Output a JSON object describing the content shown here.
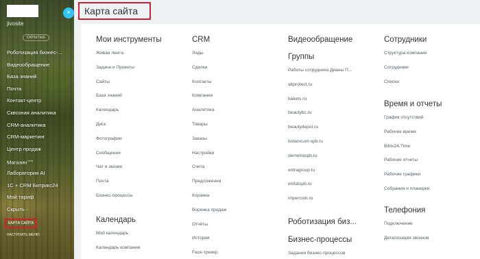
{
  "sidebar": {
    "site_name": "jivosite",
    "hidden_pill": "СКРЫТЫЕ",
    "items": [
      {
        "label": "Роботизация бизнес-..."
      },
      {
        "label": "Видеообращение"
      },
      {
        "label": "База знаний"
      },
      {
        "label": "Почта"
      },
      {
        "label": "Контакт-центр"
      },
      {
        "label": "Сквозная аналитика"
      },
      {
        "label": "CRM-аналитика"
      },
      {
        "label": "CRM-маркетинг"
      },
      {
        "label": "Центр продаж"
      },
      {
        "label": "Магазин",
        "badge": "beta"
      },
      {
        "label": "Лаборатория AI"
      },
      {
        "label": "1С + CRM Битрикс24"
      },
      {
        "label": "Мой тариф"
      },
      {
        "label": "Скрыть -"
      }
    ],
    "sitemap_label": "КАРТА САЙТА",
    "configure_label": "НАСТРОИТЬ МЕНЮ"
  },
  "close_button": "×",
  "panel": {
    "title": "Карта сайта",
    "columns": [
      {
        "sections": [
          {
            "title": "Мои инструменты",
            "links": [
              "Живая лента",
              "Задачи и Проекты",
              "Сайты",
              "База знаний",
              "Календарь",
              "Диск",
              "Фотографии",
              "Сообщения",
              "Чат и звонки",
              "Почта",
              "Бизнес-процессы"
            ]
          },
          {
            "title": "Календарь",
            "links": [
              "Мой календарь",
              "Календарь компании"
            ]
          }
        ]
      },
      {
        "sections": [
          {
            "title": "CRM",
            "links": [
              "Лиды",
              "Сделки",
              "Контакты",
              "Компании",
              "Аналитика",
              "Товары",
              "Заказы",
              "Настройки",
              "Счета",
              "Предложения",
              "Корзина",
              "Воронка продаж",
              "Отчёты",
              "История",
              "Face-трекер"
            ]
          }
        ]
      },
      {
        "sections": [
          {
            "title": "Видеообращение",
            "links": []
          },
          {
            "title": "Группы",
            "links": [
              "Работы сотрудника Дианы П...",
              "abprotect.ru",
              "bakets.ru",
              "beautybc.ru",
              "beautydepot.ru",
              "botanicum-spb.ru",
              "demetraspb.ru",
              "entragroup.ru",
              "etrilatspb.ru",
              "impercoin.ru"
            ]
          },
          {
            "title": "Роботизация биз...",
            "links": []
          },
          {
            "title": "Бизнес-процессы",
            "links": [
              "Задания бизнес-процессов"
            ]
          }
        ]
      },
      {
        "sections": [
          {
            "title": "Сотрудники",
            "links": [
              "Структура компании",
              "Сотрудники",
              "Списки"
            ]
          },
          {
            "title": "Время и отчеты",
            "links": [
              "График отсутствий",
              "Рабочее время",
              "Bitrix24.Time",
              "Рабочие отчеты",
              "Рабочие графики",
              "Собрания и планерки"
            ]
          },
          {
            "title": "Телефония",
            "links": [
              "Подключение",
              "Детализация звонков"
            ]
          }
        ]
      }
    ]
  }
}
